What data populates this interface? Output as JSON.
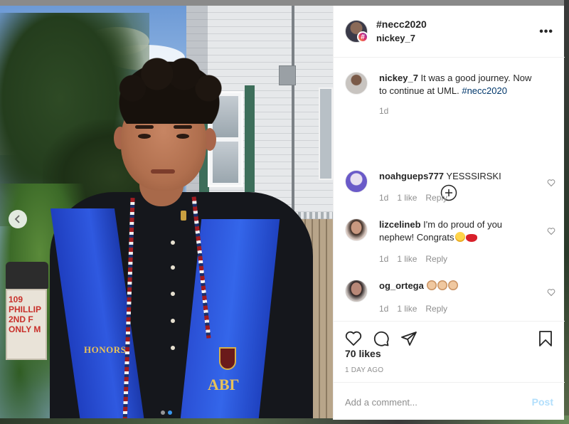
{
  "post": {
    "header": {
      "hashtag": "#necc2020",
      "username": "nickey_7",
      "badge_icon": "hashtag-badge-icon",
      "more_icon": "more-options-icon"
    },
    "caption": {
      "username": "nickey_7",
      "text": " It was a good journey. Now to continue at UML. ",
      "hashtag": "#necc2020",
      "time": "1d"
    },
    "load_more_icon": "plus-circle-icon",
    "comments": [
      {
        "username": "noahgueps777",
        "text": " YESSSIRSKI",
        "time": "1d",
        "likes": "1 like",
        "reply": "Reply"
      },
      {
        "username": "lizcelineb",
        "text": " I'm do proud of you nephew! Congrats",
        "time": "1d",
        "likes": "1 like",
        "reply": "Reply",
        "emojis": [
          "smiling-face-icon",
          "kiss-lips-icon"
        ]
      },
      {
        "username": "og_ortega",
        "text": " ",
        "time": "1d",
        "likes": "1 like",
        "reply": "Reply",
        "emojis": [
          "clapping-hands-icon",
          "clapping-hands-icon",
          "clapping-hands-icon"
        ]
      }
    ],
    "actions": {
      "like_icon": "heart-icon",
      "comment_icon": "comment-icon",
      "share_icon": "share-icon",
      "save_icon": "bookmark-icon"
    },
    "likes": "70 likes",
    "date": "1 DAY AGO",
    "add_comment": {
      "placeholder": "Add a comment...",
      "post_label": "Post"
    }
  },
  "photo": {
    "sign_text": "109\nPHILLIP\n2ND F\nONLY M",
    "house_number": "109",
    "stole_left_text": "HONORS",
    "stole_right_text": "ΑΒΓ",
    "carousel_prev_icon": "chevron-left-icon",
    "slide_count": 2,
    "active_slide": 2
  },
  "colors": {
    "link": "#00376b",
    "muted": "#8e8e8e",
    "text": "#262626",
    "post_disabled": "#b2dffc",
    "carousel_active": "#3897f0"
  }
}
